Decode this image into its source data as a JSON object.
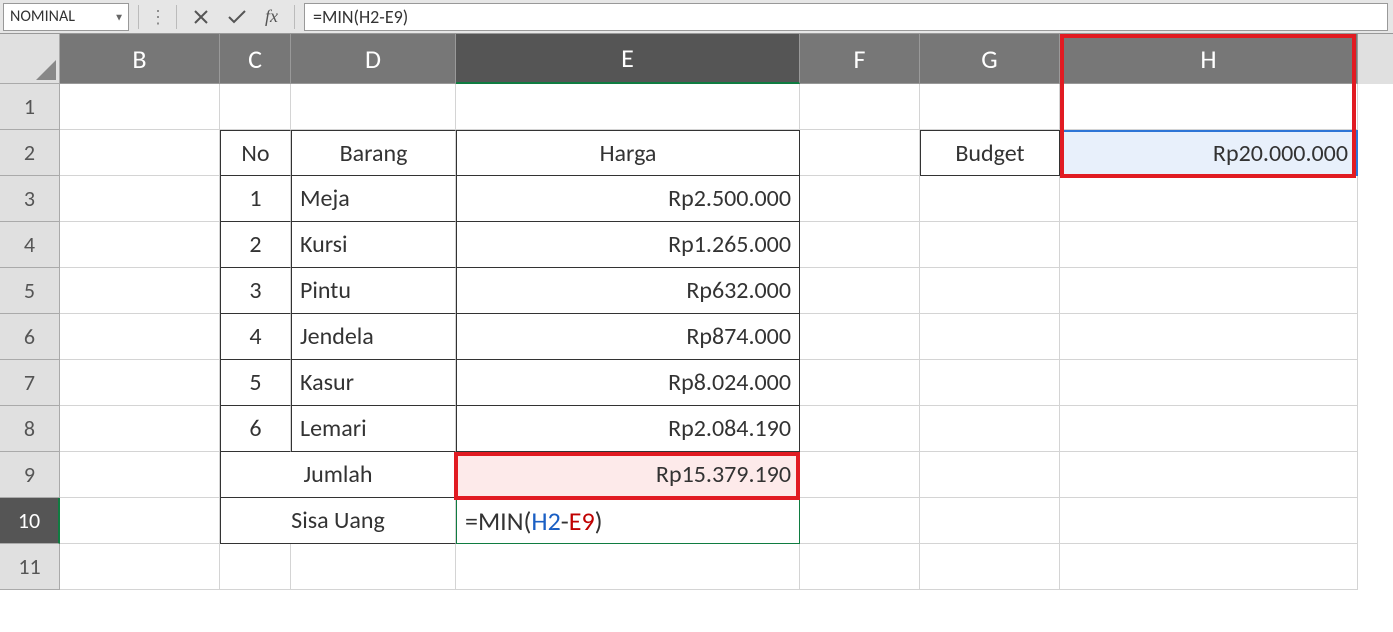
{
  "formula_bar": {
    "name_box": "NOMINAL",
    "fx_label": "fx",
    "formula": "=MIN(H2-E9)"
  },
  "columns": [
    "B",
    "C",
    "D",
    "E",
    "F",
    "G",
    "H"
  ],
  "rows": [
    "1",
    "2",
    "3",
    "4",
    "5",
    "6",
    "7",
    "8",
    "9",
    "10",
    "11"
  ],
  "headers": {
    "no": "No",
    "barang": "Barang",
    "harga": "Harga",
    "budget": "Budget"
  },
  "items": [
    {
      "no": "1",
      "barang": "Meja",
      "harga": "Rp2.500.000"
    },
    {
      "no": "2",
      "barang": "Kursi",
      "harga": "Rp1.265.000"
    },
    {
      "no": "3",
      "barang": "Pintu",
      "harga": "Rp632.000"
    },
    {
      "no": "4",
      "barang": "Jendela",
      "harga": "Rp874.000"
    },
    {
      "no": "5",
      "barang": "Kasur",
      "harga": "Rp8.024.000"
    },
    {
      "no": "6",
      "barang": "Lemari",
      "harga": "Rp2.084.190"
    }
  ],
  "summary": {
    "jumlah_label": "Jumlah",
    "jumlah_value": "Rp15.379.190",
    "sisa_label": "Sisa Uang",
    "sisa_formula_plain": "=MIN(",
    "sisa_ref1": "H2",
    "sisa_dash": "-",
    "sisa_ref2": "E9",
    "sisa_close": ")"
  },
  "budget_value": "Rp20.000.000"
}
